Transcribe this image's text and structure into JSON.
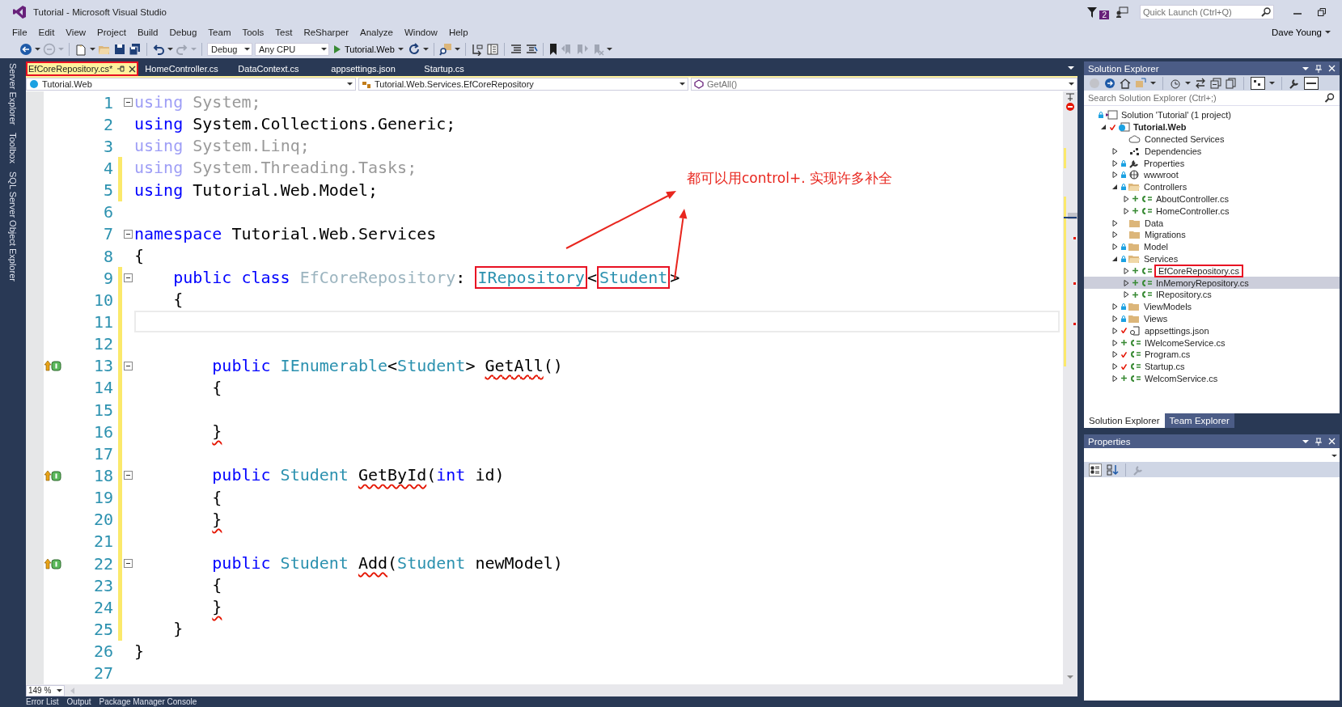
{
  "window": {
    "title": "Tutorial - Microsoft Visual Studio",
    "notifications": "2",
    "quick_launch_placeholder": "Quick Launch (Ctrl+Q)",
    "user": "Dave Young"
  },
  "menu": [
    "File",
    "Edit",
    "View",
    "Project",
    "Build",
    "Debug",
    "Team",
    "Tools",
    "Test",
    "ReSharper",
    "Analyze",
    "Window",
    "Help"
  ],
  "toolbar": {
    "configuration": "Debug",
    "platform": "Any CPU",
    "start": "Tutorial.Web"
  },
  "side_tabs": [
    "Server Explorer",
    "Toolbox",
    "SQL Server Object Explorer"
  ],
  "tabs": [
    {
      "label": "EfCoreRepository.cs*",
      "selected": true,
      "marked": true
    },
    {
      "label": "HomeController.cs",
      "selected": false,
      "marked": false
    },
    {
      "label": "DataContext.cs",
      "selected": false,
      "marked": false
    },
    {
      "label": "appsettings.json",
      "selected": false,
      "marked": false
    },
    {
      "label": "Startup.cs",
      "selected": false,
      "marked": false
    }
  ],
  "nav": {
    "project": "Tutorial.Web",
    "type": "Tutorial.Web.Services.EfCoreRepository",
    "member": "GetAll()"
  },
  "editor": {
    "zoom": "149 %",
    "lines": [
      {
        "number": "1",
        "kind": "namespace-level",
        "fold": true,
        "changed": false,
        "implements": false,
        "current": false,
        "tokens": [
          {
            "text": "using",
            "kind": "kw-dim"
          },
          {
            "text": " System;",
            "kind": "dim"
          }
        ]
      },
      {
        "number": "2",
        "kind": "namespace-level",
        "fold": false,
        "changed": false,
        "implements": false,
        "current": false,
        "tokens": [
          {
            "text": "using",
            "kind": "kw"
          },
          {
            "text": " System.Collections.Generic;",
            "kind": "plain"
          }
        ]
      },
      {
        "number": "3",
        "kind": "namespace-level",
        "fold": false,
        "changed": false,
        "implements": false,
        "current": false,
        "tokens": [
          {
            "text": "using",
            "kind": "kw-dim"
          },
          {
            "text": " System.Linq;",
            "kind": "dim"
          }
        ]
      },
      {
        "number": "4",
        "kind": "namespace-level",
        "fold": false,
        "changed": true,
        "implements": false,
        "current": false,
        "tokens": [
          {
            "text": "using",
            "kind": "kw-dim"
          },
          {
            "text": " System.Threading.Tasks;",
            "kind": "dim"
          }
        ]
      },
      {
        "number": "5",
        "kind": "namespace-level",
        "fold": false,
        "changed": true,
        "implements": false,
        "current": false,
        "tokens": [
          {
            "text": "using",
            "kind": "kw"
          },
          {
            "text": " Tutorial.Web.Model;",
            "kind": "plain"
          }
        ]
      },
      {
        "number": "6",
        "kind": "blank",
        "fold": false,
        "changed": false,
        "implements": false,
        "current": false
      },
      {
        "number": "7",
        "kind": "namespace-level",
        "fold": true,
        "changed": false,
        "implements": false,
        "current": false,
        "tokens": [
          {
            "text": "namespace",
            "kind": "kw"
          },
          {
            "text": " Tutorial.Web.Services",
            "kind": "plain"
          }
        ]
      },
      {
        "number": "8",
        "kind": "namespace-level",
        "fold": false,
        "changed": false,
        "implements": false,
        "current": false,
        "tokens": [
          {
            "text": "{",
            "kind": "plain"
          }
        ]
      },
      {
        "number": "9",
        "kind": "class-level",
        "fold": true,
        "changed": true,
        "implements": false,
        "current": false,
        "tokens": [
          {
            "text": "public class ",
            "kind": "kw"
          },
          {
            "text": "EfCoreRepository",
            "kind": "type-dim"
          },
          {
            "text": ": ",
            "kind": "plain"
          },
          {
            "text": "IRepository",
            "kind": "type-marked"
          },
          {
            "text": "<",
            "kind": "plain"
          },
          {
            "text": "Student",
            "kind": "type-marked"
          },
          {
            "text": ">",
            "kind": "plain"
          }
        ]
      },
      {
        "number": "10",
        "kind": "class-level",
        "fold": false,
        "changed": true,
        "implements": false,
        "current": false,
        "tokens": [
          {
            "text": "{",
            "kind": "plain"
          }
        ]
      },
      {
        "number": "11",
        "kind": "blank",
        "fold": false,
        "changed": true,
        "implements": false,
        "current": true
      },
      {
        "number": "12",
        "kind": "blank",
        "fold": false,
        "changed": true,
        "implements": false,
        "current": false
      },
      {
        "number": "13",
        "kind": "member-level",
        "fold": true,
        "changed": true,
        "implements": true,
        "current": false,
        "tokens": [
          {
            "text": "public ",
            "kind": "kw"
          },
          {
            "text": "IEnumerable",
            "kind": "type"
          },
          {
            "text": "<",
            "kind": "plain"
          },
          {
            "text": "Student",
            "kind": "type"
          },
          {
            "text": "> ",
            "kind": "plain"
          },
          {
            "text": "GetAll",
            "kind": "error"
          },
          {
            "text": "()",
            "kind": "plain"
          }
        ]
      },
      {
        "number": "14",
        "kind": "member-level",
        "fold": false,
        "changed": true,
        "implements": false,
        "current": false,
        "tokens": [
          {
            "text": "{",
            "kind": "plain"
          }
        ]
      },
      {
        "number": "15",
        "kind": "blank",
        "fold": false,
        "changed": true,
        "implements": false,
        "current": false
      },
      {
        "number": "16",
        "kind": "member-level",
        "fold": false,
        "changed": true,
        "implements": false,
        "current": false,
        "tokens": [
          {
            "text": "}",
            "kind": "error"
          }
        ]
      },
      {
        "number": "17",
        "kind": "blank",
        "fold": false,
        "changed": true,
        "implements": false,
        "current": false
      },
      {
        "number": "18",
        "kind": "member-level",
        "fold": true,
        "changed": true,
        "implements": true,
        "current": false,
        "tokens": [
          {
            "text": "public ",
            "kind": "kw"
          },
          {
            "text": "Student ",
            "kind": "type"
          },
          {
            "text": "GetById",
            "kind": "error"
          },
          {
            "text": "(",
            "kind": "plain"
          },
          {
            "text": "int",
            "kind": "kw"
          },
          {
            "text": " id)",
            "kind": "plain"
          }
        ]
      },
      {
        "number": "19",
        "kind": "member-level",
        "fold": false,
        "changed": true,
        "implements": false,
        "current": false,
        "tokens": [
          {
            "text": "{",
            "kind": "plain"
          }
        ]
      },
      {
        "number": "20",
        "kind": "member-level",
        "fold": false,
        "changed": true,
        "implements": false,
        "current": false,
        "tokens": [
          {
            "text": "}",
            "kind": "error"
          }
        ]
      },
      {
        "number": "21",
        "kind": "blank",
        "fold": false,
        "changed": true,
        "implements": false,
        "current": false
      },
      {
        "number": "22",
        "kind": "member-level",
        "fold": true,
        "changed": true,
        "implements": true,
        "current": false,
        "tokens": [
          {
            "text": "public ",
            "kind": "kw"
          },
          {
            "text": "Student ",
            "kind": "type"
          },
          {
            "text": "Add",
            "kind": "error"
          },
          {
            "text": "(",
            "kind": "plain"
          },
          {
            "text": "Student",
            "kind": "type"
          },
          {
            "text": " newModel)",
            "kind": "plain"
          }
        ]
      },
      {
        "number": "23",
        "kind": "member-level",
        "fold": false,
        "changed": true,
        "implements": false,
        "current": false,
        "tokens": [
          {
            "text": "{",
            "kind": "plain"
          }
        ]
      },
      {
        "number": "24",
        "kind": "member-level",
        "fold": false,
        "changed": true,
        "implements": false,
        "current": false,
        "tokens": [
          {
            "text": "}",
            "kind": "error"
          }
        ]
      },
      {
        "number": "25",
        "kind": "class-level",
        "fold": false,
        "changed": true,
        "implements": false,
        "current": false,
        "tokens": [
          {
            "text": "}",
            "kind": "plain"
          }
        ]
      },
      {
        "number": "26",
        "kind": "namespace-level",
        "fold": false,
        "changed": false,
        "implements": false,
        "current": false,
        "tokens": [
          {
            "text": "}",
            "kind": "plain"
          }
        ]
      },
      {
        "number": "27",
        "kind": "blank",
        "fold": false,
        "changed": false,
        "implements": false,
        "current": false
      }
    ]
  },
  "annotation": {
    "text": "都可以用control+. 实现许多补全"
  },
  "bottom_tabs": [
    "Error List",
    "Output",
    "Package Manager Console"
  ],
  "solution_explorer": {
    "title": "Solution Explorer",
    "search_placeholder": "Search Solution Explorer (Ctrl+;)",
    "tree": [
      {
        "label": "Solution 'Tutorial' (1 project)",
        "kind": "solution",
        "locked": true,
        "pending_add": false,
        "checked_in": false,
        "selected": false,
        "marked": false,
        "children": [
          {
            "label": "Tutorial.Web",
            "kind": "project",
            "locked": false,
            "pending_add": false,
            "checked_in": true,
            "expanded": true,
            "selected": false,
            "marked": false,
            "children": [
              {
                "label": "Connected Services",
                "kind": "cloud",
                "locked": false,
                "pending_add": false,
                "checked_in": false,
                "selected": false,
                "marked": false
              },
              {
                "label": "Dependencies",
                "kind": "deps",
                "locked": false,
                "pending_add": false,
                "checked_in": false,
                "expanded": false,
                "selected": false,
                "marked": false
              },
              {
                "label": "Properties",
                "kind": "wrench",
                "locked": true,
                "pending_add": false,
                "checked_in": false,
                "expanded": false,
                "selected": false,
                "marked": false
              },
              {
                "label": "wwwroot",
                "kind": "globe",
                "locked": true,
                "pending_add": false,
                "checked_in": false,
                "expanded": false,
                "selected": false,
                "marked": false
              },
              {
                "label": "Controllers",
                "kind": "folder",
                "locked": true,
                "pending_add": false,
                "checked_in": false,
                "expanded": true,
                "selected": false,
                "marked": false,
                "children": [
                  {
                    "label": "AboutController.cs",
                    "kind": "cs",
                    "locked": false,
                    "pending_add": true,
                    "checked_in": false,
                    "expanded": false,
                    "selected": false,
                    "marked": false
                  },
                  {
                    "label": "HomeController.cs",
                    "kind": "cs",
                    "locked": false,
                    "pending_add": true,
                    "checked_in": false,
                    "expanded": false,
                    "selected": false,
                    "marked": false
                  }
                ]
              },
              {
                "label": "Data",
                "kind": "folder",
                "locked": false,
                "pending_add": false,
                "checked_in": false,
                "expanded": false,
                "selected": false,
                "marked": false
              },
              {
                "label": "Migrations",
                "kind": "folder",
                "locked": false,
                "pending_add": false,
                "checked_in": false,
                "expanded": false,
                "selected": false,
                "marked": false
              },
              {
                "label": "Model",
                "kind": "folder",
                "locked": true,
                "pending_add": false,
                "checked_in": false,
                "expanded": false,
                "selected": false,
                "marked": false
              },
              {
                "label": "Services",
                "kind": "folder",
                "locked": true,
                "pending_add": false,
                "checked_in": false,
                "expanded": true,
                "selected": false,
                "marked": false,
                "children": [
                  {
                    "label": "EfCoreRepository.cs",
                    "kind": "cs",
                    "locked": false,
                    "pending_add": true,
                    "checked_in": false,
                    "expanded": false,
                    "selected": false,
                    "marked": true
                  },
                  {
                    "label": "InMemoryRepository.cs",
                    "kind": "cs",
                    "locked": false,
                    "pending_add": true,
                    "checked_in": false,
                    "expanded": false,
                    "selected": true,
                    "marked": false
                  },
                  {
                    "label": "IRepository.cs",
                    "kind": "cs",
                    "locked": false,
                    "pending_add": true,
                    "checked_in": false,
                    "expanded": false,
                    "selected": false,
                    "marked": false
                  }
                ]
              },
              {
                "label": "ViewModels",
                "kind": "folder",
                "locked": true,
                "pending_add": false,
                "checked_in": false,
                "expanded": false,
                "selected": false,
                "marked": false
              },
              {
                "label": "Views",
                "kind": "folder",
                "locked": true,
                "pending_add": false,
                "checked_in": false,
                "expanded": false,
                "selected": false,
                "marked": false
              },
              {
                "label": "appsettings.json",
                "kind": "json",
                "locked": false,
                "pending_add": false,
                "checked_in": true,
                "expanded": false,
                "selected": false,
                "marked": false
              },
              {
                "label": "IWelcomeService.cs",
                "kind": "cs",
                "locked": false,
                "pending_add": true,
                "checked_in": false,
                "expanded": false,
                "selected": false,
                "marked": false
              },
              {
                "label": "Program.cs",
                "kind": "cs",
                "locked": false,
                "pending_add": false,
                "checked_in": true,
                "expanded": false,
                "selected": false,
                "marked": false
              },
              {
                "label": "Startup.cs",
                "kind": "cs",
                "locked": false,
                "pending_add": false,
                "checked_in": true,
                "expanded": false,
                "selected": false,
                "marked": false
              },
              {
                "label": "WelcomService.cs",
                "kind": "cs",
                "locked": false,
                "pending_add": true,
                "checked_in": false,
                "expanded": false,
                "selected": false,
                "marked": false
              }
            ]
          }
        ]
      }
    ],
    "tabs": [
      {
        "label": "Solution Explorer",
        "selected": true
      },
      {
        "label": "Team Explorer",
        "selected": false
      }
    ]
  },
  "properties": {
    "title": "Properties"
  }
}
